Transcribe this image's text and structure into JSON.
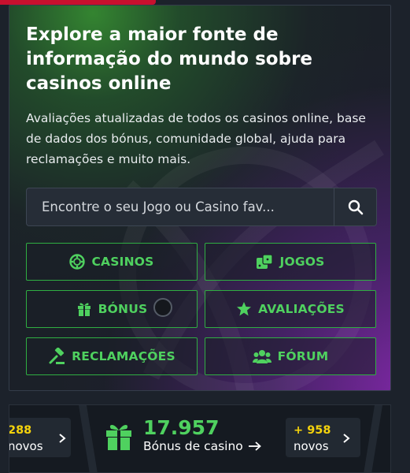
{
  "hero": {
    "title": "Explore a maior fonte de informação do mundo sobre casinos online",
    "subtitle": "Avaliações atualizadas de todos os casinos online, base de dados dos bónus, comunidade global, ajuda para reclamações e muito mais.",
    "search_placeholder": "Encontre o seu Jogo ou Casino fav...",
    "search_icon": "search-icon"
  },
  "nav": {
    "casinos": {
      "label": "CASINOS",
      "icon": "casino-chip-icon"
    },
    "jogos": {
      "label": "JOGOS",
      "icon": "dice-icon"
    },
    "bonus": {
      "label": "BÓNUS",
      "icon": "gift-icon"
    },
    "avaliacoes": {
      "label": "AVALIAÇÕES",
      "icon": "star-icon"
    },
    "reclamacoes": {
      "label": "RECLAMAÇÕES",
      "icon": "gavel-icon"
    },
    "forum": {
      "label": "FÓRUM",
      "icon": "users-icon"
    }
  },
  "stats": {
    "left_count": "288",
    "left_label": "novos",
    "bonus_count": "17.957",
    "bonus_label": "Bónus de casino",
    "right_count": "+ 958",
    "right_label": "novos"
  },
  "colors": {
    "accent_green": "#4fd15f",
    "border_green": "#2fae42",
    "highlight_yellow": "#f4d20c",
    "brand_red": "#c8102e"
  }
}
